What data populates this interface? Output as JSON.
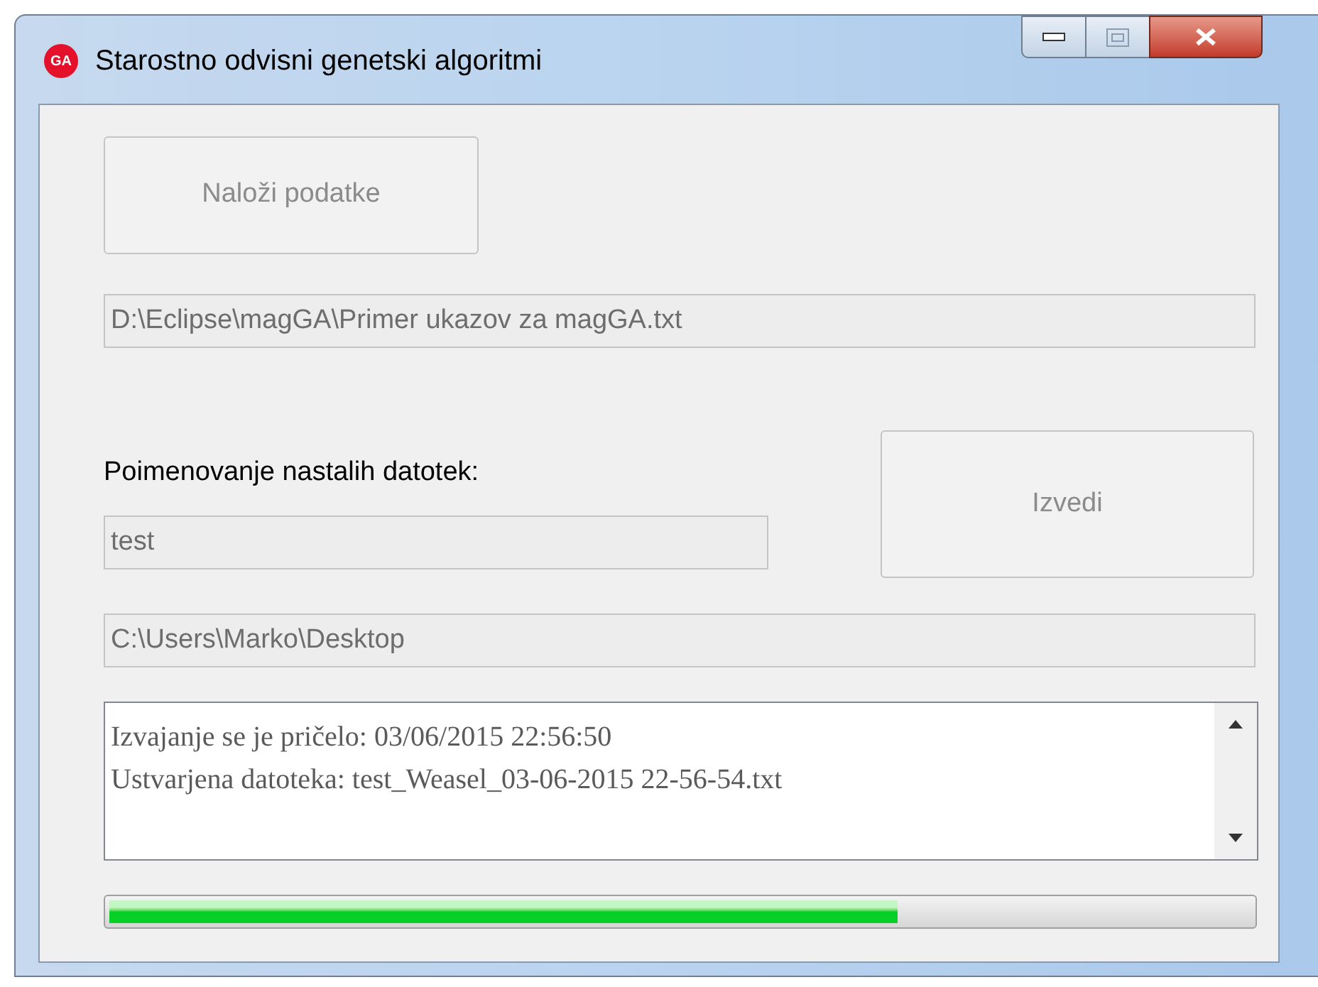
{
  "window": {
    "title": "Starostno odvisni genetski algoritmi",
    "logo": "GA"
  },
  "load_button": {
    "label": "Naloži podatke",
    "disabled": true
  },
  "input_path": {
    "value": "D:\\Eclipse\\magGA\\Primer ukazov za magGA.txt",
    "disabled": true
  },
  "naming_label": "Poimenovanje nastalih datotek:",
  "name_field": {
    "value": "test",
    "disabled": true
  },
  "run_button": {
    "label": "Izvedi",
    "disabled": true
  },
  "output_path": {
    "value": "C:\\Users\\Marko\\Desktop",
    "disabled": true
  },
  "log": [
    "Izvajanje se je pričelo: 03/06/2015 22:56:50",
    "Ustvarjena datoteka: test_Weasel_03-06-2015 22-56-54.txt"
  ],
  "progress": {
    "level": 0.69
  }
}
